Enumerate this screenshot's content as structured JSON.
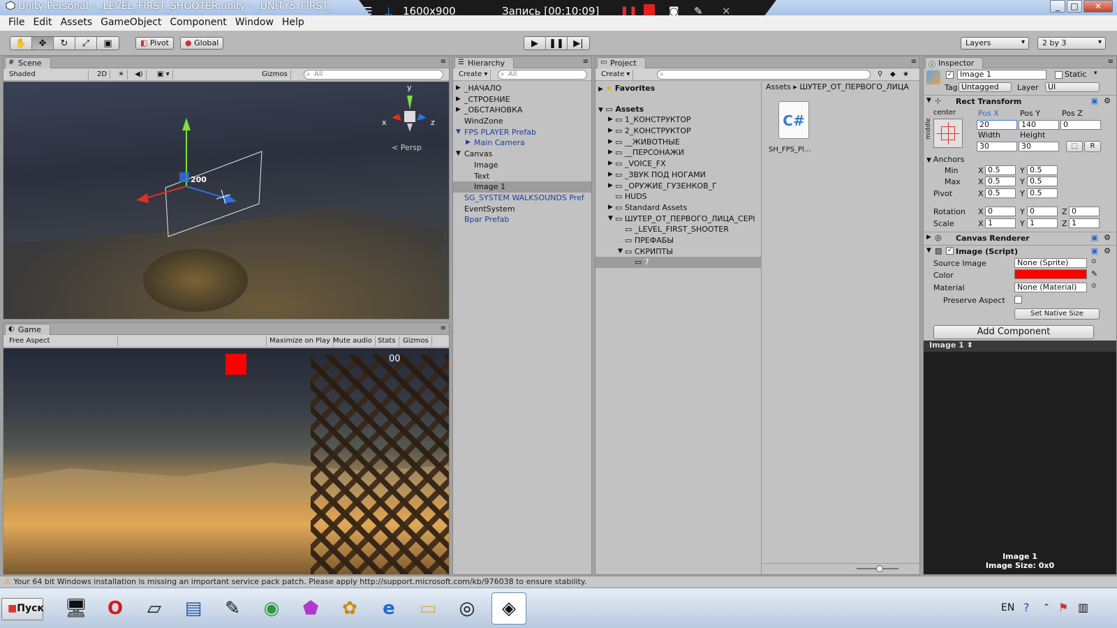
{
  "window": {
    "title": "Unity Personal - _LEVEL_FIRST_SHOOTER.unity - _UNITY5_FIRST_"
  },
  "recorder": {
    "resolution": "1600x900",
    "status": "Запись [00:10:09]"
  },
  "menu": [
    "File",
    "Edit",
    "Assets",
    "GameObject",
    "Component",
    "Window",
    "Help"
  ],
  "toolbar": {
    "pivot": "Pivot",
    "global": "Global",
    "layers": "Layers",
    "layout": "2 by 3"
  },
  "scene": {
    "tab": "Scene",
    "shading": "Shaded",
    "mode_2d": "2D",
    "gizmos": "Gizmos",
    "search_placeholder": "All",
    "projection": "< Persp",
    "size_label": "200",
    "axes": {
      "x": "x",
      "y": "y",
      "z": "z"
    }
  },
  "game": {
    "tab": "Game",
    "aspect": "Free Aspect",
    "maximize": "Maximize on Play",
    "mute": "Mute audio",
    "stats": "Stats",
    "gizmos": "Gizmos",
    "counter": "00",
    "square_color": "#ff0000"
  },
  "hierarchy": {
    "tab": "Hierarchy",
    "create": "Create",
    "search_placeholder": "All",
    "items": [
      {
        "label": "_НАЧАЛО",
        "indent": 0,
        "arrow": "▶",
        "style": ""
      },
      {
        "label": "_СТРОЕНИЕ",
        "indent": 0,
        "arrow": "▶",
        "style": ""
      },
      {
        "label": "_ОБСТАНОВКА",
        "indent": 0,
        "arrow": "▶",
        "style": ""
      },
      {
        "label": "WindZone",
        "indent": 0,
        "arrow": "",
        "style": ""
      },
      {
        "label": "FPS PLAYER Prefab",
        "indent": 0,
        "arrow": "▼",
        "style": "blue"
      },
      {
        "label": "Main Camera",
        "indent": 1,
        "arrow": "▶",
        "style": "blue"
      },
      {
        "label": "Canvas",
        "indent": 0,
        "arrow": "▼",
        "style": ""
      },
      {
        "label": "Image",
        "indent": 1,
        "arrow": "",
        "style": ""
      },
      {
        "label": "Text",
        "indent": 1,
        "arrow": "",
        "style": ""
      },
      {
        "label": "Image 1",
        "indent": 1,
        "arrow": "",
        "style": "sel"
      },
      {
        "label": "SG_SYSTEM WALKSOUNDS Pref",
        "indent": 0,
        "arrow": "",
        "style": "blue"
      },
      {
        "label": "EventSystem",
        "indent": 0,
        "arrow": "",
        "style": ""
      },
      {
        "label": "Bpar Prefab",
        "indent": 0,
        "arrow": "",
        "style": "blue"
      }
    ]
  },
  "project": {
    "tab": "Project",
    "create": "Create",
    "favorites": "Favorites",
    "assets_root": "Assets",
    "breadcrumb": "Assets ▸ ШУТЕР_ОТ_ПЕРВОГО_ЛИЦА",
    "file_name": "SH_FPS_Pl...",
    "file_icon": "C#",
    "folders": [
      {
        "label": "1_КОНСТРУКТОР",
        "indent": 1,
        "arrow": "▶",
        "sel": false
      },
      {
        "label": "2_КОНСТРУКТОР",
        "indent": 1,
        "arrow": "▶",
        "sel": false
      },
      {
        "label": "__ЖИВОТНЫЕ",
        "indent": 1,
        "arrow": "▶",
        "sel": false
      },
      {
        "label": "__ПЕРСОНАЖИ",
        "indent": 1,
        "arrow": "▶",
        "sel": false
      },
      {
        "label": "_VOICE_FX",
        "indent": 1,
        "arrow": "▶",
        "sel": false
      },
      {
        "label": "_ЗВУК ПОД НОГАМИ",
        "indent": 1,
        "arrow": "▶",
        "sel": false
      },
      {
        "label": "_ОРУЖИЕ_ГУЗЕНКОВ_Г",
        "indent": 1,
        "arrow": "▶",
        "sel": false
      },
      {
        "label": "HUDS",
        "indent": 1,
        "arrow": "",
        "sel": false
      },
      {
        "label": "Standard Assets",
        "indent": 1,
        "arrow": "▶",
        "sel": false
      },
      {
        "label": "ШУТЕР_ОТ_ПЕРВОГО_ЛИЦА_СЕРІ",
        "indent": 1,
        "arrow": "▼",
        "sel": false
      },
      {
        "label": "_LEVEL_FIRST_SHOOTER",
        "indent": 2,
        "arrow": "",
        "sel": false
      },
      {
        "label": "ПРЕФАБЫ",
        "indent": 2,
        "arrow": "",
        "sel": false
      },
      {
        "label": "СКРИПТЫ",
        "indent": 2,
        "arrow": "▼",
        "sel": false
      },
      {
        "label": "7",
        "indent": 3,
        "arrow": "",
        "sel": true
      }
    ]
  },
  "inspector": {
    "tab": "Inspector",
    "object_name": "Image 1",
    "static": "Static",
    "tag_label": "Tag",
    "tag": "Untagged",
    "layer_label": "Layer",
    "layer": "UI",
    "rect_transform": {
      "title": "Rect Transform",
      "anchor_h": "center",
      "anchor_v": "middle",
      "pos_x_label": "Pos X",
      "pos_y_label": "Pos Y",
      "pos_z_label": "Pos Z",
      "pos_x": "20",
      "pos_y": "140",
      "pos_z": "0",
      "width_label": "Width",
      "height_label": "Height",
      "width": "30",
      "height": "30",
      "anchors_label": "Anchors",
      "min_label": "Min",
      "max_label": "Max",
      "pivot_label": "Pivot",
      "min_x": "0.5",
      "min_y": "0.5",
      "max_x": "0.5",
      "max_y": "0.5",
      "pivot_x": "0.5",
      "pivot_y": "0.5",
      "rotation_label": "Rotation",
      "scale_label": "Scale",
      "rot_x": "0",
      "rot_y": "0",
      "rot_z": "0",
      "scale_x": "1",
      "scale_y": "1",
      "scale_z": "1",
      "x": "X",
      "y": "Y",
      "z": "Z",
      "r_button": "R"
    },
    "canvas_renderer": {
      "title": "Canvas Renderer"
    },
    "image_script": {
      "title": "Image (Script)",
      "source_label": "Source Image",
      "source": "None (Sprite)",
      "color_label": "Color",
      "color": "#ff0000",
      "material_label": "Material",
      "material": "None (Material)",
      "preserve_label": "Preserve Aspect",
      "native_size": "Set Native Size"
    },
    "add_component": "Add Component",
    "preview_caption": "Image 1",
    "preview_name": "Image 1",
    "preview_size": "Image Size: 0x0"
  },
  "status": "Your 64 bit Windows installation is missing an important service pack patch. Please apply http://support.microsoft.com/kb/976038 to ensure stability.",
  "taskbar": {
    "start": "Пуск",
    "lang": "EN"
  }
}
